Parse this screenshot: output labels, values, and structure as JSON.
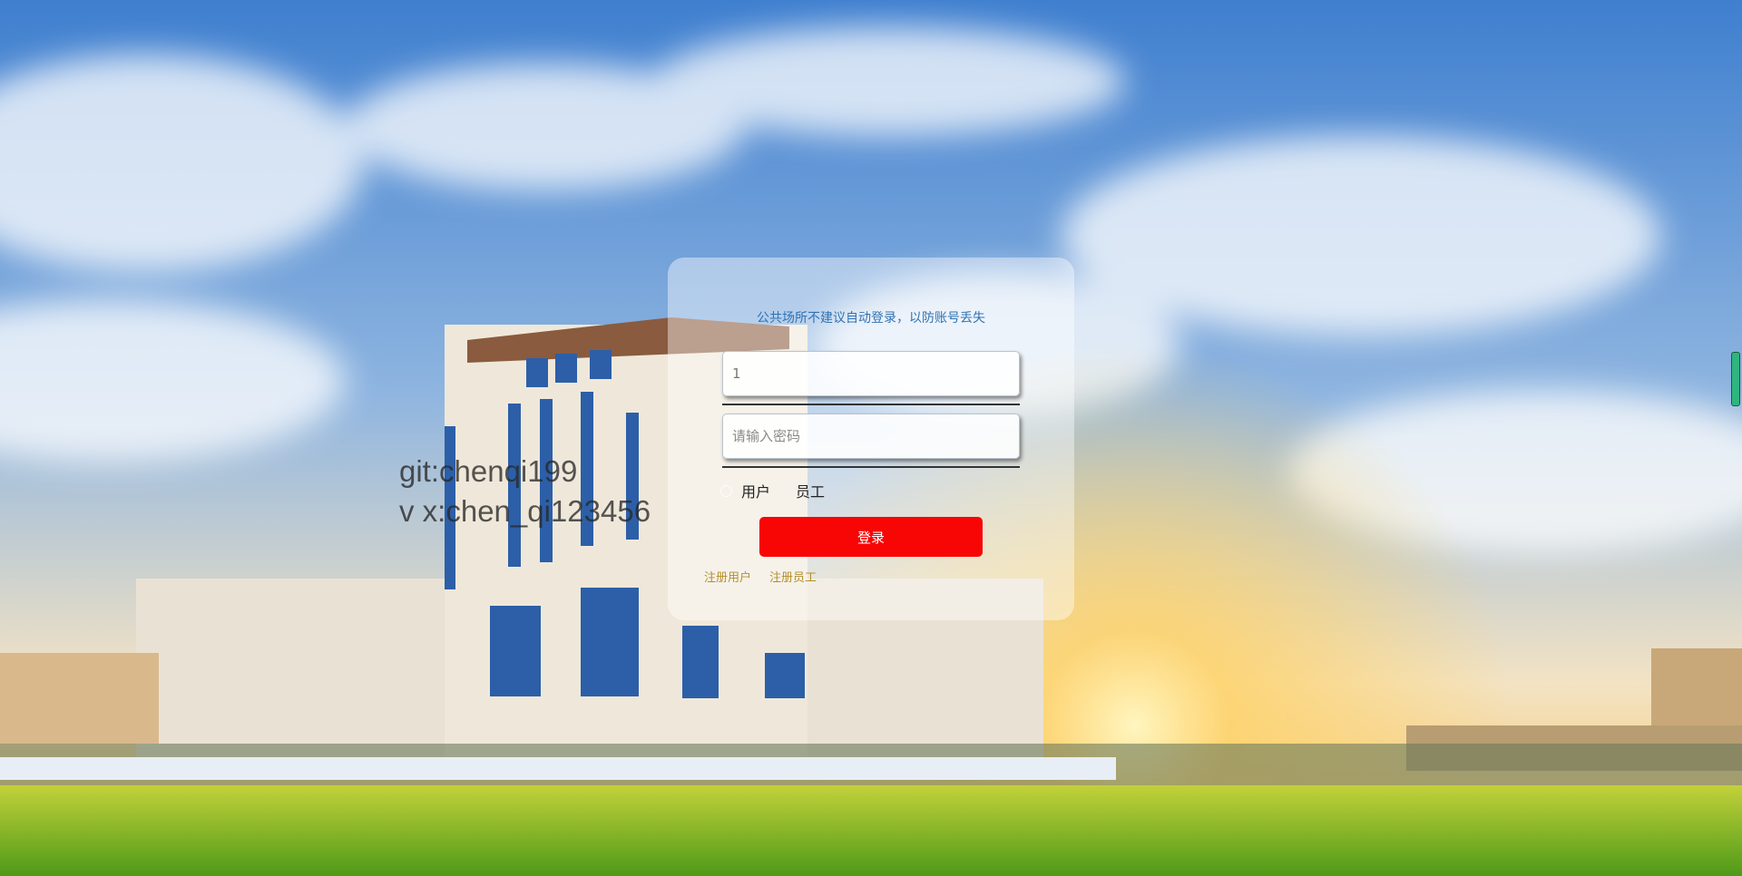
{
  "watermark": {
    "line1": "git:chenqi199",
    "line2": "v x:chen_qi123456"
  },
  "login": {
    "notice": "公共场所不建议自动登录，以防账号丢失",
    "username_value": "1",
    "password_placeholder": "请输入密码",
    "roles": [
      "用户",
      "员工"
    ],
    "login_button": "登录",
    "register_user": "注册用户",
    "register_staff": "注册员工"
  },
  "colors": {
    "button": "#f80505",
    "notice": "#2f73b3",
    "links": "#b58f2a"
  }
}
